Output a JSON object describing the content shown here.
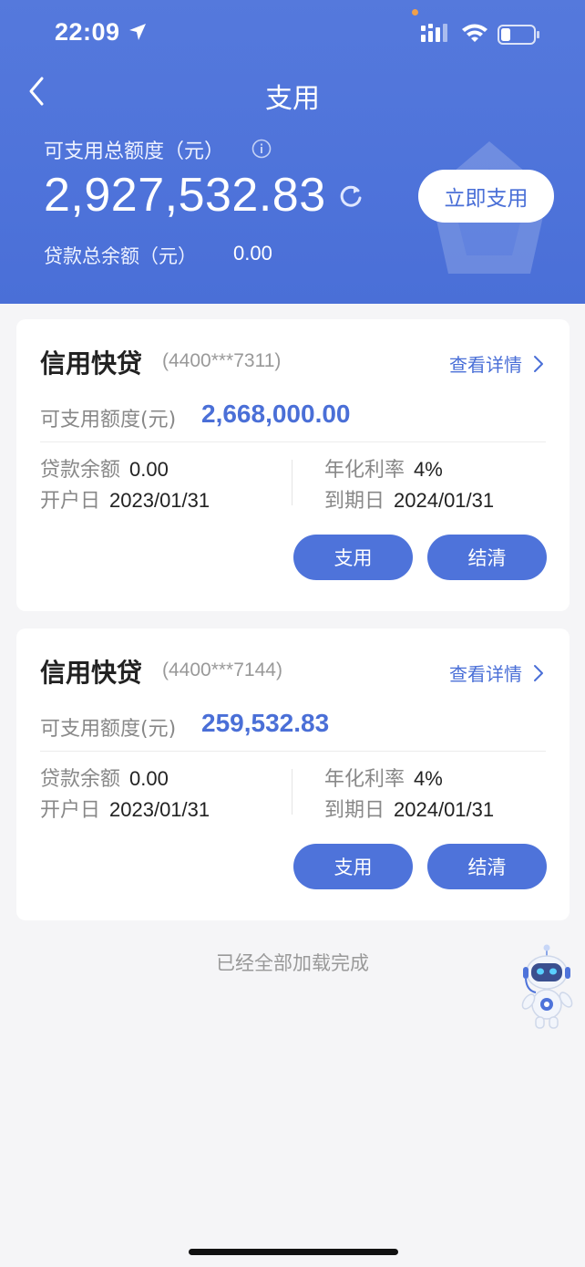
{
  "status_bar": {
    "time": "22:09"
  },
  "nav": {
    "title": "支用"
  },
  "summary": {
    "total_label": "可支用总额度（元）",
    "total_amount": "2,927,532.83",
    "use_now_label": "立即支用",
    "loan_total_label": "贷款总余额（元）",
    "loan_total_value": "0.00"
  },
  "cards": [
    {
      "title": "信用快贷",
      "account": "(4400***7311)",
      "detail_label": "查看详情",
      "available_label": "可支用额度(元)",
      "available_value": "2,668,000.00",
      "balance_label": "贷款余额",
      "balance_value": "0.00",
      "open_date_label": "开户日",
      "open_date_value": "2023/01/31",
      "rate_label": "年化利率",
      "rate_value": "4%",
      "due_label": "到期日",
      "due_value": "2024/01/31",
      "use_label": "支用",
      "settle_label": "结清"
    },
    {
      "title": "信用快贷",
      "account": "(4400***7144)",
      "detail_label": "查看详情",
      "available_label": "可支用额度(元)",
      "available_value": "259,532.83",
      "balance_label": "贷款余额",
      "balance_value": "0.00",
      "open_date_label": "开户日",
      "open_date_value": "2023/01/31",
      "rate_label": "年化利率",
      "rate_value": "4%",
      "due_label": "到期日",
      "due_value": "2024/01/31",
      "use_label": "支用",
      "settle_label": "结清"
    }
  ],
  "footer": {
    "text": "已经全部加载完成"
  },
  "icons": {
    "back": "back-arrow-icon",
    "info": "info-icon",
    "refresh": "refresh-icon",
    "chevron": "chevron-right-icon",
    "assistant": "robot-assistant-icon"
  },
  "colors": {
    "primary": "#4e73da",
    "background": "#f5f5f7"
  }
}
